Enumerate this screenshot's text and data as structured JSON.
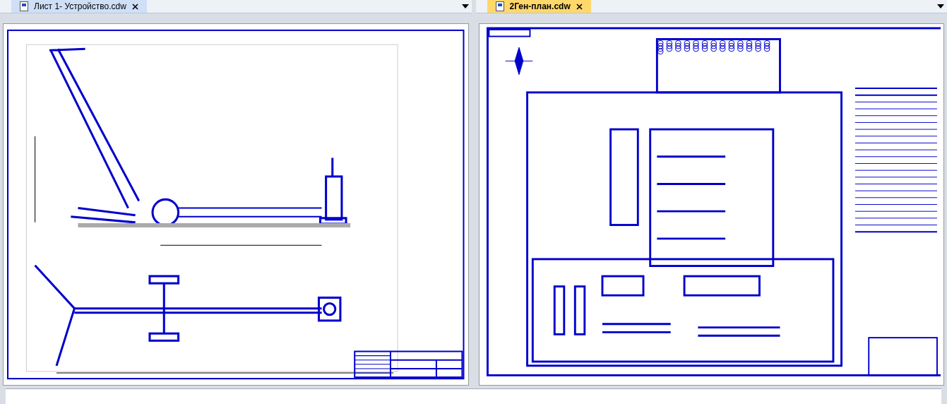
{
  "panes": [
    {
      "tab": {
        "label": "Лист 1- Устройство.cdw",
        "selected": false
      },
      "kind": "device"
    },
    {
      "tab": {
        "label": "2Ген-план.cdw",
        "selected": true
      },
      "kind": "plan"
    }
  ]
}
